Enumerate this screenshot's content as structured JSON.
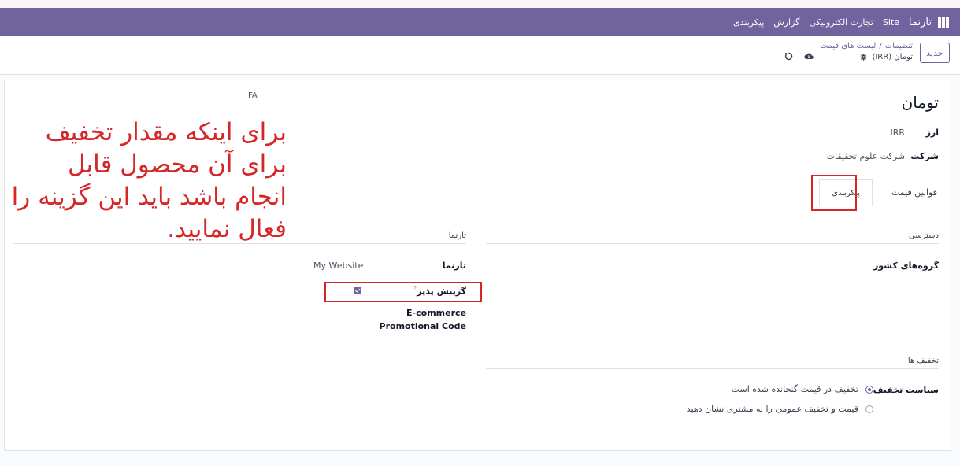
{
  "navbar": {
    "brand": "تارنما",
    "items": [
      "Site",
      "تجارت الکترونیکی",
      "گزارش",
      "پیکربندی"
    ]
  },
  "control": {
    "new_button": "جدید",
    "breadcrumb": [
      "تنظیمات",
      "لیست های قیمت"
    ],
    "breadcrumb_sep": "/",
    "current_record": "تومان (IRR)"
  },
  "form": {
    "title": "تومان",
    "language_code": "FA",
    "currency_label": "ارز",
    "currency_value": "IRR",
    "company_label": "شرکت",
    "company_value": "شرکت علوم تحقیقات"
  },
  "tabs": {
    "rules": "قوانین قیمت",
    "configuration": "پیکربندی"
  },
  "config": {
    "availability_title": "دسترسی",
    "country_groups_label": "گروه‌های کشور",
    "website_section_title": "تارنما",
    "website_label": "تارنما",
    "website_value": "My Website",
    "selectable_label": "گزینش پذیر",
    "selectable_help": "?",
    "selectable_checked": true,
    "ecommerce_label": "E-commerce",
    "promo_label": "Promotional Code",
    "discounts_title": "تخفیف ها",
    "discount_policy_label": "سیاست تخفیف",
    "discount_options": [
      "تخفیف در قیمت گنجانده شده است",
      "قیمت و تخفیف عمومی را به مشتری نشان دهید"
    ],
    "selected_option": 0
  },
  "annotation": {
    "text": "برای اینکه مقدار تخفیف برای آن محصول قابل انجام باشد باید این گزینه را فعال نمایید."
  },
  "colors": {
    "brand": "#71639e",
    "annotation": "#d62728"
  }
}
